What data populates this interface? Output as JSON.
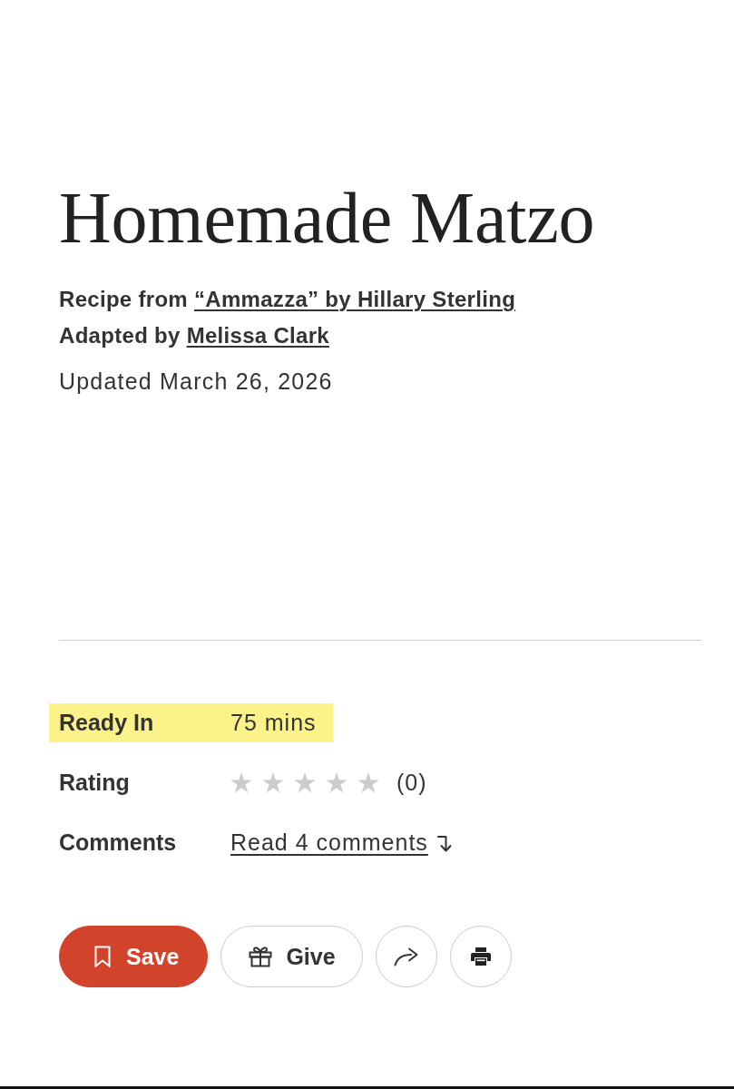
{
  "title": "Homemade Matzo",
  "credits": [
    {
      "prefix": "Recipe from",
      "link": "“Ammazza” by Hillary Sterling"
    },
    {
      "prefix": "Adapted by",
      "link": "Melissa Clark"
    }
  ],
  "updated": "Updated March 26, 2026",
  "details": [
    {
      "kind": "text",
      "label": "Ready In",
      "value": "75 mins",
      "highlighted": true
    },
    {
      "kind": "rating",
      "label": "Rating",
      "stars": 0,
      "count": "(0)",
      "highlighted": false
    },
    {
      "kind": "link",
      "label": "Comments",
      "value": "Read 4 comments",
      "highlighted": false
    }
  ],
  "actions": [
    {
      "kind": "save",
      "label": "Save"
    },
    {
      "kind": "give",
      "label": "Give"
    },
    {
      "kind": "share"
    },
    {
      "kind": "print"
    }
  ]
}
